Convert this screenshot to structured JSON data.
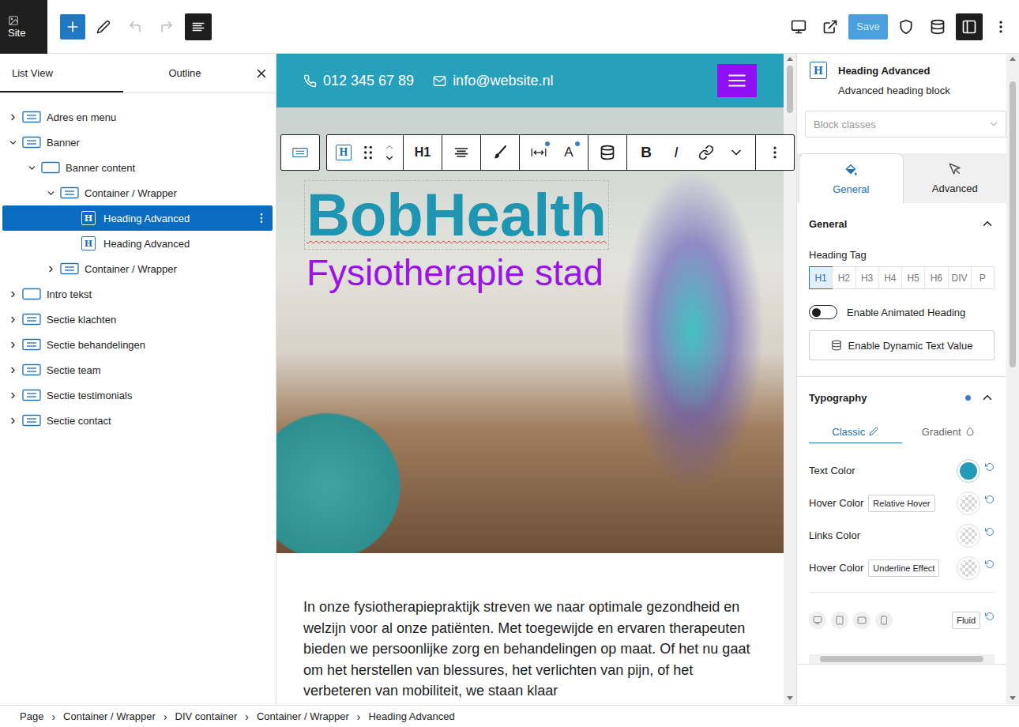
{
  "topbar": {
    "site_label": "Site",
    "save": {
      "label": "Save",
      "disabled": true
    }
  },
  "block_icon_glyph": "H",
  "list_panel": {
    "tabs": [
      {
        "label": "List View",
        "selected": true
      },
      {
        "label": "Outline",
        "selected": false
      }
    ],
    "items": [
      {
        "label": "Adres en menu",
        "kind": "group",
        "has_children": true,
        "expanded": false,
        "selected": false,
        "children": []
      },
      {
        "label": "Banner",
        "kind": "group",
        "has_children": true,
        "expanded": true,
        "selected": false,
        "children": [
          {
            "label": "Banner content",
            "kind": "box",
            "has_children": true,
            "expanded": true,
            "selected": false,
            "children": [
              {
                "label": "Container / Wrapper",
                "kind": "group",
                "has_children": true,
                "expanded": true,
                "selected": false,
                "children": [
                  {
                    "label": "Heading Advanced",
                    "kind": "heading",
                    "has_children": false,
                    "expanded": false,
                    "selected": true,
                    "children": []
                  },
                  {
                    "label": "Heading Advanced",
                    "kind": "heading",
                    "has_children": false,
                    "expanded": false,
                    "selected": false,
                    "children": []
                  }
                ]
              },
              {
                "label": "Container / Wrapper",
                "kind": "group",
                "has_children": true,
                "expanded": false,
                "selected": false,
                "children": []
              }
            ]
          }
        ]
      },
      {
        "label": "Intro tekst",
        "kind": "box",
        "has_children": true,
        "expanded": false,
        "selected": false,
        "children": []
      },
      {
        "label": "Sectie klachten",
        "kind": "group",
        "has_children": true,
        "expanded": false,
        "selected": false,
        "children": []
      },
      {
        "label": "Sectie behandelingen",
        "kind": "group",
        "has_children": true,
        "expanded": false,
        "selected": false,
        "children": []
      },
      {
        "label": "Sectie team",
        "kind": "group",
        "has_children": true,
        "expanded": false,
        "selected": false,
        "children": []
      },
      {
        "label": "Sectie testimonials",
        "kind": "group",
        "has_children": true,
        "expanded": false,
        "selected": false,
        "children": []
      },
      {
        "label": "Sectie contact",
        "kind": "group",
        "has_children": true,
        "expanded": false,
        "selected": false,
        "children": []
      }
    ]
  },
  "block_toolbar": {
    "heading_level": "H1",
    "font_glyph": "A",
    "bold": "B",
    "italic": "I",
    "width_modified": true,
    "font_modified": true
  },
  "canvas": {
    "header": {
      "phone": "012 345 67 89",
      "email": "info@website.nl"
    },
    "hero": {
      "title": "BobHealth",
      "subtitle": "Fysiotherapie stad",
      "title_selected": true
    },
    "paragraph": "In onze fysiotherapiepraktijk streven we naar optimale gezondheid en welzijn voor al onze patiënten. Met toegewijde en ervaren therapeuten bieden we persoonlijke zorg en behandelingen op maat. Of het nu gaat om het herstellen van blessures, het verlichten van pijn, of het verbeteren van mobiliteit, we staan klaar"
  },
  "sidebar": {
    "block": {
      "title": "Heading Advanced",
      "description": "Advanced heading block"
    },
    "classes_placeholder": "Block classes",
    "tabs": [
      {
        "label": "General",
        "selected": true
      },
      {
        "label": "Advanced",
        "selected": false
      }
    ],
    "general": {
      "title": "General",
      "expanded": true,
      "tag_label": "Heading Tag",
      "tags": [
        {
          "label": "H1",
          "selected": true
        },
        {
          "label": "H2",
          "selected": false
        },
        {
          "label": "H3",
          "selected": false
        },
        {
          "label": "H4",
          "selected": false
        },
        {
          "label": "H5",
          "selected": false
        },
        {
          "label": "H6",
          "selected": false
        },
        {
          "label": "DIV",
          "selected": false
        },
        {
          "label": "P",
          "selected": false
        }
      ],
      "animated": {
        "label": "Enable Animated Heading",
        "on": false
      },
      "dynamic_button": "Enable Dynamic Text Value"
    },
    "typography": {
      "title": "Typography",
      "expanded": true,
      "modified": true,
      "modes": [
        {
          "label": "Classic",
          "selected": true
        },
        {
          "label": "Gradient",
          "selected": false
        }
      ],
      "colors": [
        {
          "label": "Text Color",
          "badge": "",
          "set": true,
          "color": "#2499b8"
        },
        {
          "label": "Hover Color",
          "badge": "Relative Hover",
          "set": false,
          "color": null
        },
        {
          "label": "Links Color",
          "badge": "",
          "set": false,
          "color": null
        },
        {
          "label": "Hover Color",
          "badge": "Underline Effect",
          "set": false,
          "color": null
        }
      ],
      "devices": [
        {
          "kind": "desktop"
        },
        {
          "kind": "tablet"
        },
        {
          "kind": "tablet-landscape"
        },
        {
          "kind": "mobile"
        }
      ],
      "fluid": "Fluid"
    }
  },
  "breadcrumbs": {
    "separator": "›",
    "items": [
      "Page",
      "Container / Wrapper",
      "DIV container",
      "Container / Wrapper",
      "Heading Advanced"
    ]
  }
}
